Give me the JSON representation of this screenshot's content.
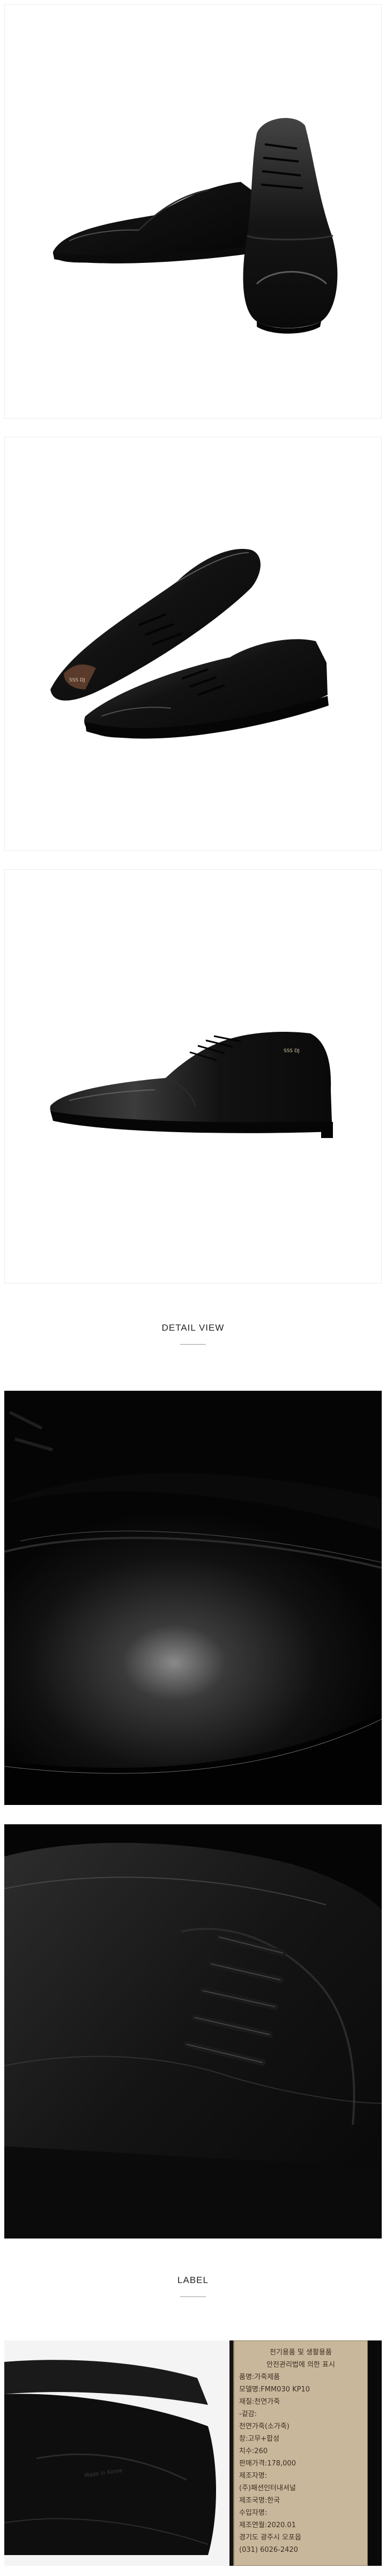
{
  "sections": {
    "detail_title": "DETAIL VIEW",
    "label_title": "LABEL"
  },
  "insole_text": "SSS DJ",
  "sole_emboss": "Made in Korea",
  "tag": {
    "lines": [
      "전기용품 및 생활용품",
      "안전관리법에 의한 표시",
      "품명:가죽제품",
      "모델명:FMM030 KP10",
      "재질:천연가죽",
      "-겉감:",
      "천연가죽(소가죽)",
      "창:고무+합성",
      "치수:260",
      "판매가격:178,000",
      "제조자명:",
      "(주)패션인터내셔널",
      "제조국명:한국",
      "수입자명:",
      "제조연월:2020.01",
      "경기도 광주시 오포읍",
      "(031) 6026-2420"
    ]
  },
  "colors": {
    "leather": "#151515",
    "leather_highlight": "#6a6a6a",
    "tag_paper": "#c9b79b",
    "rule": "#9a9a9a"
  }
}
